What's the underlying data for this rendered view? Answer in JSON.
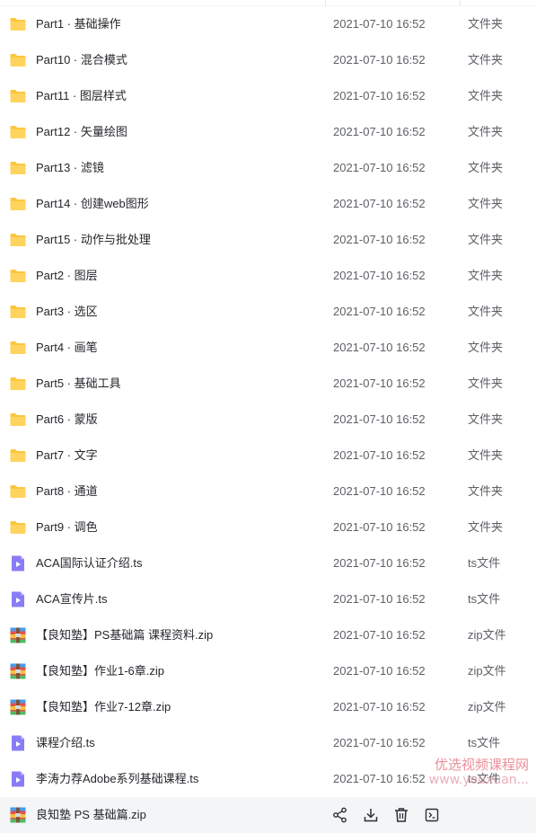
{
  "files": [
    {
      "name": "Part1 · 基础操作",
      "time": "2021-07-10 16:52",
      "type": "文件夹",
      "icon": "folder-icon"
    },
    {
      "name": "Part10 · 混合模式",
      "time": "2021-07-10 16:52",
      "type": "文件夹",
      "icon": "folder-icon"
    },
    {
      "name": "Part11 · 图层样式",
      "time": "2021-07-10 16:52",
      "type": "文件夹",
      "icon": "folder-icon"
    },
    {
      "name": "Part12 · 矢量绘图",
      "time": "2021-07-10 16:52",
      "type": "文件夹",
      "icon": "folder-icon"
    },
    {
      "name": "Part13 · 滤镜",
      "time": "2021-07-10 16:52",
      "type": "文件夹",
      "icon": "folder-icon"
    },
    {
      "name": "Part14 · 创建web图形",
      "time": "2021-07-10 16:52",
      "type": "文件夹",
      "icon": "folder-icon"
    },
    {
      "name": "Part15 · 动作与批处理",
      "time": "2021-07-10 16:52",
      "type": "文件夹",
      "icon": "folder-icon"
    },
    {
      "name": "Part2 · 图层",
      "time": "2021-07-10 16:52",
      "type": "文件夹",
      "icon": "folder-icon"
    },
    {
      "name": "Part3 · 选区",
      "time": "2021-07-10 16:52",
      "type": "文件夹",
      "icon": "folder-icon"
    },
    {
      "name": "Part4 · 画笔",
      "time": "2021-07-10 16:52",
      "type": "文件夹",
      "icon": "folder-icon"
    },
    {
      "name": "Part5 · 基础工具",
      "time": "2021-07-10 16:52",
      "type": "文件夹",
      "icon": "folder-icon"
    },
    {
      "name": "Part6 · 蒙版",
      "time": "2021-07-10 16:52",
      "type": "文件夹",
      "icon": "folder-icon"
    },
    {
      "name": "Part7 · 文字",
      "time": "2021-07-10 16:52",
      "type": "文件夹",
      "icon": "folder-icon"
    },
    {
      "name": "Part8 · 通道",
      "time": "2021-07-10 16:52",
      "type": "文件夹",
      "icon": "folder-icon"
    },
    {
      "name": "Part9 · 调色",
      "time": "2021-07-10 16:52",
      "type": "文件夹",
      "icon": "folder-icon"
    },
    {
      "name": "ACA国际认证介绍.ts",
      "time": "2021-07-10 16:52",
      "type": "ts文件",
      "icon": "video-file-icon"
    },
    {
      "name": "ACA宣传片.ts",
      "time": "2021-07-10 16:52",
      "type": "ts文件",
      "icon": "video-file-icon"
    },
    {
      "name": "【良知塾】PS基础篇 课程资料.zip",
      "time": "2021-07-10 16:52",
      "type": "zip文件",
      "icon": "zip-file-icon"
    },
    {
      "name": "【良知塾】作业1-6章.zip",
      "time": "2021-07-10 16:52",
      "type": "zip文件",
      "icon": "zip-file-icon"
    },
    {
      "name": "【良知塾】作业7-12章.zip",
      "time": "2021-07-10 16:52",
      "type": "zip文件",
      "icon": "zip-file-icon"
    },
    {
      "name": "课程介绍.ts",
      "time": "2021-07-10 16:52",
      "type": "ts文件",
      "icon": "video-file-icon"
    },
    {
      "name": "李涛力荐Adobe系列基础课程.ts",
      "time": "2021-07-10 16:52",
      "type": "ts文件",
      "icon": "video-file-icon"
    }
  ],
  "hovered_file": {
    "name": "良知塾 PS 基础篇.zip",
    "icon": "zip-file-icon",
    "actions": [
      "share-icon",
      "download-icon",
      "delete-icon",
      "more-icon"
    ]
  },
  "watermark": {
    "cn": "优选视频课程网",
    "url": "www.youxuan..."
  },
  "colors": {
    "folder": "#fcc63f",
    "video": "#8a7cf6",
    "hover_bg": "#f4f5f7"
  }
}
